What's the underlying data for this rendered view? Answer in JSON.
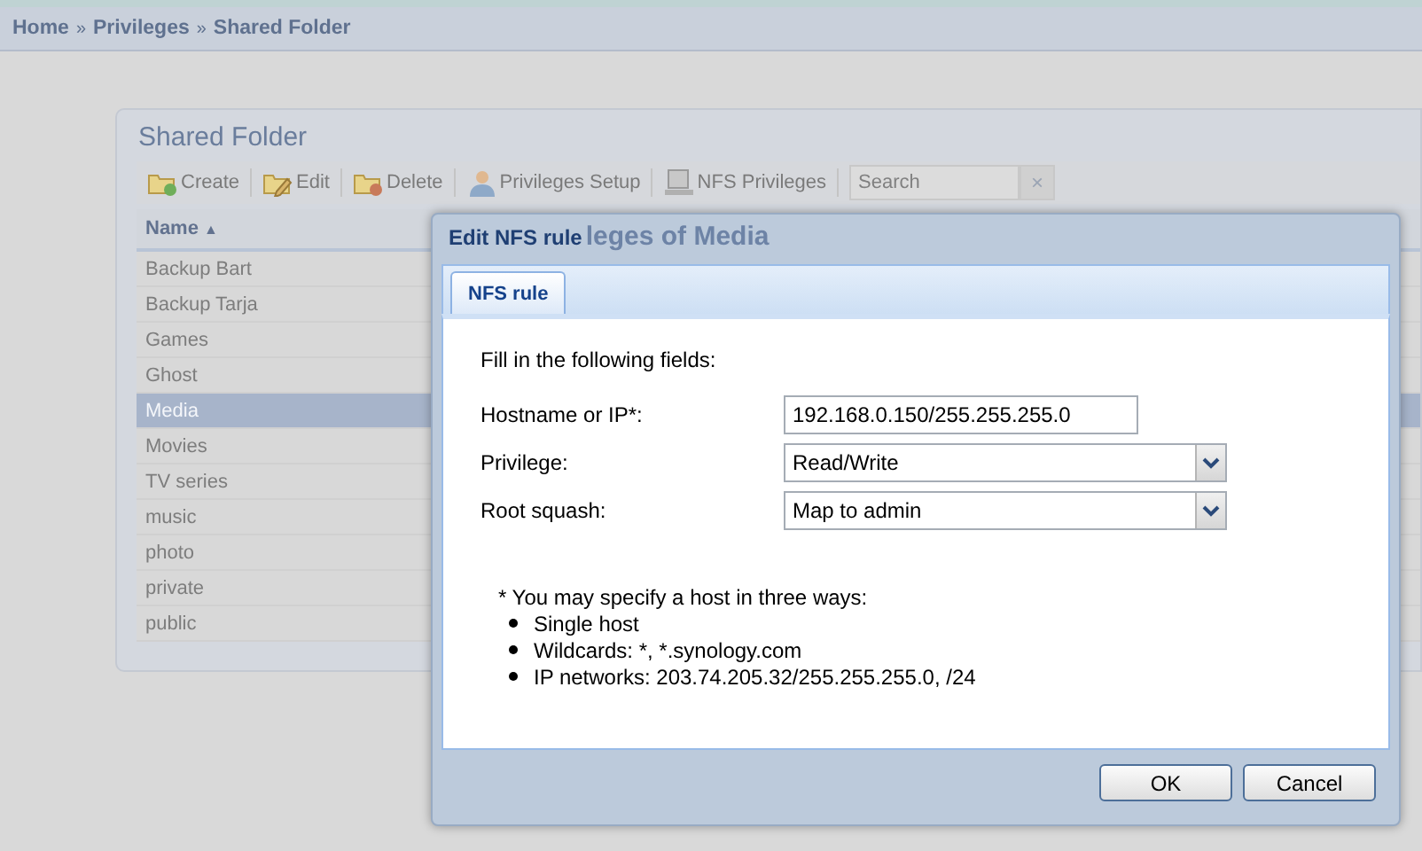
{
  "breadcrumb": {
    "items": [
      "Home",
      "Privileges",
      "Shared Folder"
    ],
    "separator": "»"
  },
  "panel": {
    "title": "Shared Folder",
    "toolbar": [
      {
        "label": "Create",
        "kind": "create"
      },
      {
        "label": "Edit",
        "kind": "edit"
      },
      {
        "label": "Delete",
        "kind": "delete"
      },
      {
        "label": "Privileges Setup",
        "kind": "users"
      },
      {
        "label": "NFS Privileges",
        "kind": "nfs"
      }
    ],
    "search": {
      "placeholder": "Search",
      "clear": "×"
    },
    "column": "Name",
    "sort_mark": "▲",
    "rows": [
      {
        "name": "Backup Bart",
        "selected": false
      },
      {
        "name": "Backup Tarja",
        "selected": false
      },
      {
        "name": "Games",
        "selected": false
      },
      {
        "name": "Ghost",
        "selected": false
      },
      {
        "name": "Media",
        "selected": true
      },
      {
        "name": "Movies",
        "selected": false
      },
      {
        "name": "TV series",
        "selected": false
      },
      {
        "name": "music",
        "selected": false
      },
      {
        "name": "photo",
        "selected": false
      },
      {
        "name": "private",
        "selected": false
      },
      {
        "name": "public",
        "selected": false
      }
    ]
  },
  "background_window_title": "leges of Media",
  "dialog": {
    "title": "Edit NFS rule",
    "tabs": [
      {
        "label": "NFS rule",
        "selected": true
      }
    ],
    "intro": "Fill in the following fields:",
    "fields": [
      {
        "label": "Hostname or IP*:",
        "kind": "text",
        "value": "192.168.0.150/255.255.255.0"
      },
      {
        "label": "Privilege:",
        "kind": "select",
        "value": "Read/Write"
      },
      {
        "label": "Root squash:",
        "kind": "select",
        "value": "Map to admin"
      }
    ],
    "note": "* You may specify a host in three ways:",
    "note_items": [
      "Single host",
      "Wildcards: *, *.synology.com",
      "IP networks: 203.74.205.32/255.255.255.0, /24"
    ],
    "buttons": [
      "OK",
      "Cancel"
    ]
  }
}
